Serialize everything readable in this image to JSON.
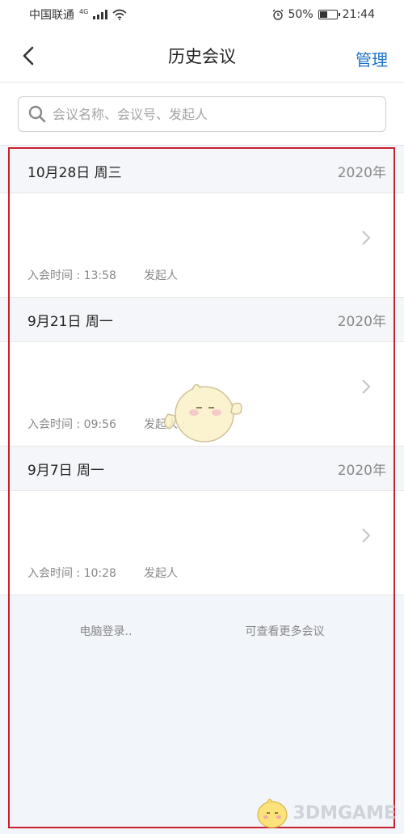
{
  "status_bar": {
    "carrier": "中国联通",
    "network": "4G",
    "battery": "50%",
    "battery_level": 0.5,
    "time": "21:44"
  },
  "nav": {
    "title": "历史会议",
    "manage_label": "管理",
    "back_icon": "chevron-left-icon"
  },
  "search": {
    "placeholder": "会议名称、会议号、发起人",
    "value": "",
    "icon": "search-icon"
  },
  "groups": [
    {
      "date": "10月28日 周三",
      "year": "2020年",
      "meeting": {
        "join_label": "入会时间 : 13:58",
        "host_label": "发起人"
      }
    },
    {
      "date": "9月21日 周一",
      "year": "2020年",
      "meeting": {
        "join_label": "入会时间 : 09:56",
        "host_label": "发起人 :"
      }
    },
    {
      "date": "9月7日 周一",
      "year": "2020年",
      "meeting": {
        "join_label": "入会时间 : 10:28",
        "host_label": "发起人"
      }
    }
  ],
  "footer": {
    "left": "电脑登录..",
    "right": "可查看更多会议"
  },
  "watermark": "3DMGAME",
  "colors": {
    "accent": "#1a73c8",
    "highlight_border": "#c9202e",
    "background": "#f2f5fa"
  }
}
